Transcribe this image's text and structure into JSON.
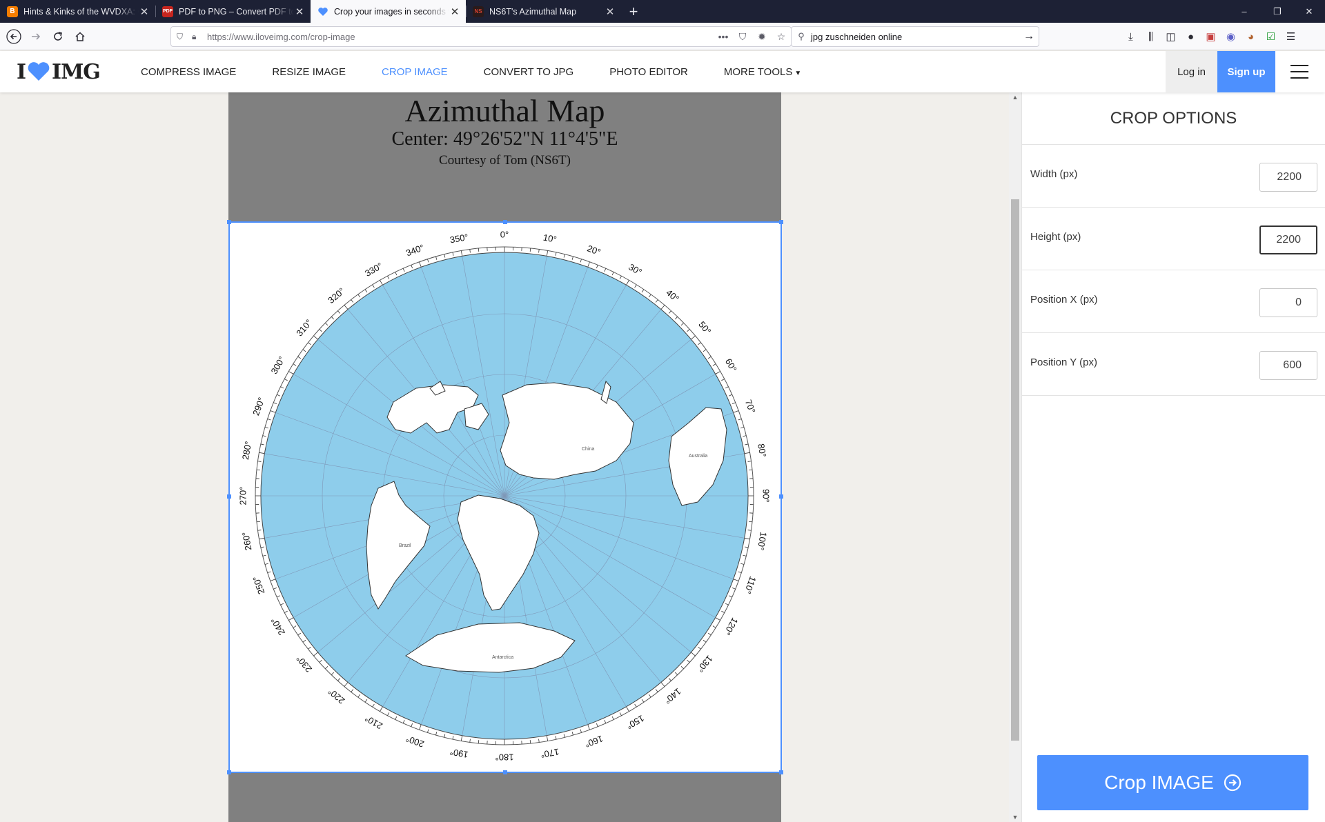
{
  "browser": {
    "tabs": [
      {
        "title": "Hints & Kinks of the WVDXA: C",
        "icon": "blogger-favicon",
        "icon_glyph": "B"
      },
      {
        "title": "PDF to PNG – Convert PDF to P",
        "icon": "pdf-favicon",
        "icon_glyph": "PDF"
      },
      {
        "title": "Crop your images in seconds f",
        "icon": "iloveimg-favicon",
        "icon_glyph": ""
      },
      {
        "title": "NS6T's Azimuthal Map",
        "icon": "ns6t-favicon",
        "icon_glyph": "NS"
      }
    ],
    "new_tab_glyph": "+",
    "window_controls": {
      "minimize": "–",
      "maximize": "❐",
      "close": "✕"
    },
    "url": "https://www.iloveimg.com/crop-image",
    "search_text": "jpg zuschneiden online"
  },
  "site": {
    "logo_left": "I",
    "logo_right": "IMG",
    "nav": [
      {
        "label": "COMPRESS IMAGE"
      },
      {
        "label": "RESIZE IMAGE"
      },
      {
        "label": "CROP IMAGE",
        "active": true
      },
      {
        "label": "CONVERT TO JPG"
      },
      {
        "label": "PHOTO EDITOR"
      },
      {
        "label": "MORE TOOLS"
      }
    ],
    "login_label": "Log in",
    "signup_label": "Sign up"
  },
  "document": {
    "title": "Azimuthal Map",
    "center": "Center: 49°26'52\"N 11°4'5\"E",
    "courtesy": "Courtesy of Tom (NS6T)",
    "map_labels": {
      "china": "China",
      "australia": "Australia",
      "brazil": "Brazil",
      "antarctica": "Antarctica"
    },
    "bearings": [
      "0°",
      "10°",
      "20°",
      "30°",
      "40°",
      "50°",
      "60°",
      "70°",
      "80°",
      "90°",
      "100°",
      "110°",
      "120°",
      "130°",
      "140°",
      "150°",
      "160°",
      "170°",
      "180°",
      "190°",
      "200°",
      "210°",
      "220°",
      "230°",
      "240°",
      "250°",
      "260°",
      "270°",
      "280°",
      "290°",
      "300°",
      "310°",
      "320°",
      "330°",
      "340°",
      "350°"
    ]
  },
  "crop_options": {
    "title": "CROP OPTIONS",
    "fields": [
      {
        "label": "Width (px)",
        "value": "2200"
      },
      {
        "label": "Height (px)",
        "value": "2200"
      },
      {
        "label": "Position X (px)",
        "value": "0"
      },
      {
        "label": "Position Y (px)",
        "value": "600"
      }
    ],
    "button_label": "Crop IMAGE"
  },
  "colors": {
    "accent": "#4d90fe",
    "ocean": "#8ecdeb",
    "browser_frame": "#1d2135"
  }
}
